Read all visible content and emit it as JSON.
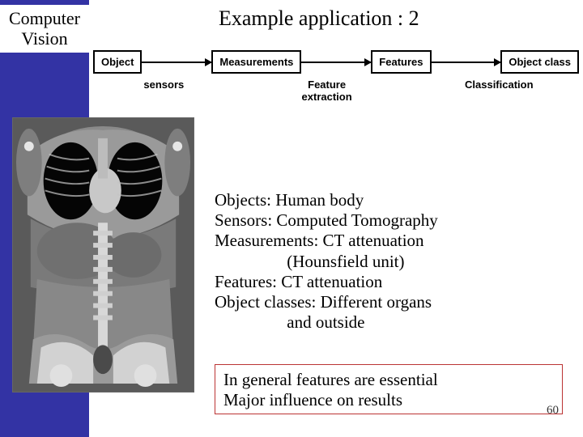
{
  "sidebar": {
    "title_l1": "Computer",
    "title_l2": "Vision"
  },
  "slide": {
    "title": "Example application : 2",
    "page_number": "60"
  },
  "flow": {
    "boxes": [
      "Object",
      "Measurements",
      "Features",
      "Object class"
    ],
    "labels": [
      "sensors",
      "Feature\nextraction",
      "Classification"
    ]
  },
  "body": {
    "text": "Objects: Human body\nSensors: Computed Tomography\nMeasurements: CT attenuation\n                 (Hounsfield unit)\nFeatures: CT attenuation\nObject classes: Different organs\n                 and outside"
  },
  "summary": {
    "line1": "In general features are essential",
    "line2": "Major influence on results"
  },
  "image": {
    "alt": "ct-scan-coronal-human-body"
  }
}
